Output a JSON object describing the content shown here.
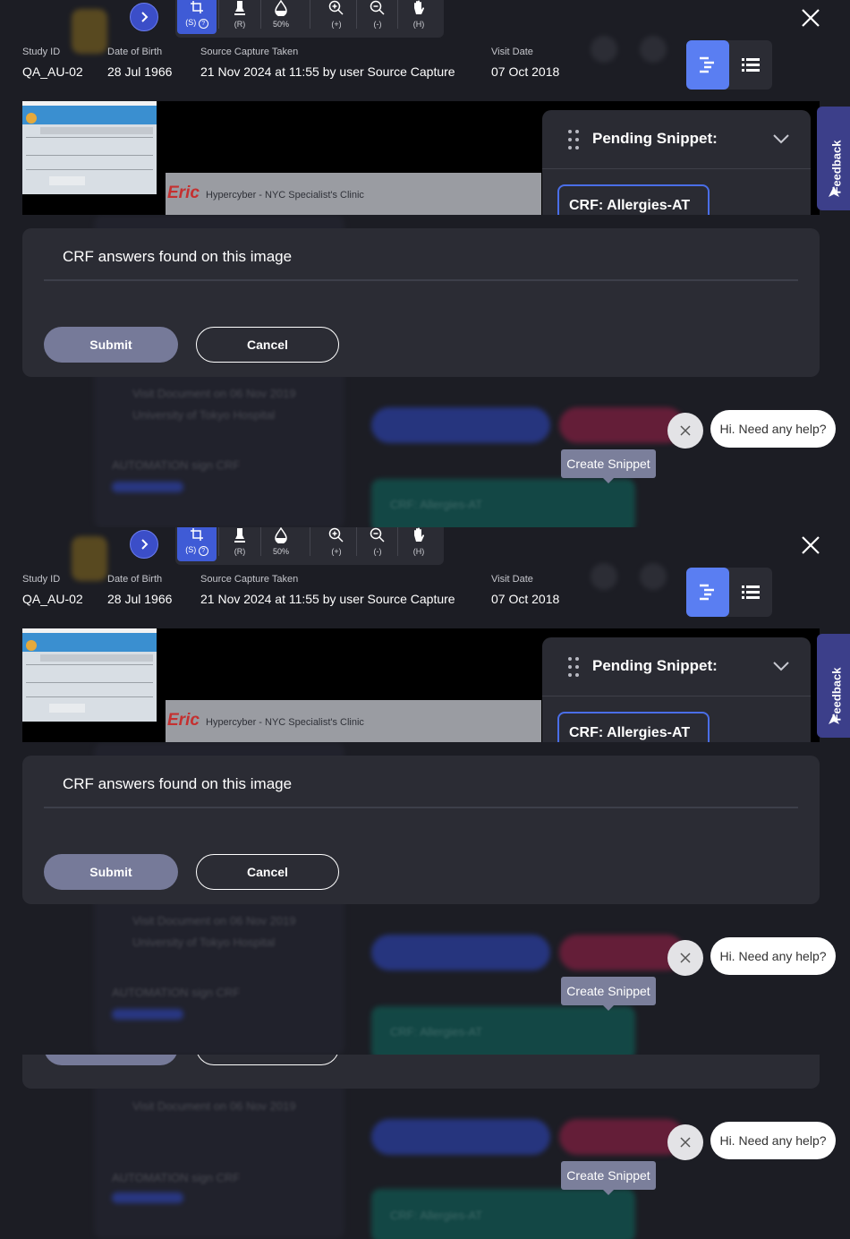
{
  "toolbar": {
    "tools": [
      {
        "key": "(S)",
        "label": "(S)"
      },
      {
        "key": "(R)",
        "label": "(R)"
      },
      {
        "key": "50%",
        "label": "50%"
      },
      {
        "key": "(+)",
        "label": "(+)"
      },
      {
        "key": "(-)",
        "label": "(-)"
      },
      {
        "key": "(H)",
        "label": "(H)"
      }
    ],
    "help_glyph": "?"
  },
  "meta": {
    "study_id_label": "Study ID",
    "study_id": "QA_AU-02",
    "dob_label": "Date of Birth",
    "dob": "28 Jul 1966",
    "capture_label": "Source Capture Taken",
    "capture": "21 Nov 2024 at 11:55 by user Source Capture",
    "visit_label": "Visit Date",
    "visit": "07 Oct 2018"
  },
  "image": {
    "brand": "Eric",
    "clinic": "Hypercyber - NYC Specialist's Clinic"
  },
  "pending": {
    "title": "Pending Snippet:",
    "tag": "CRF: Allergies-AT"
  },
  "feedback": {
    "label": "Feedback"
  },
  "answers": {
    "title": "CRF answers found on this image",
    "submit": "Submit",
    "cancel": "Cancel"
  },
  "help": {
    "text": "Hi. Need any help?"
  },
  "tooltip": {
    "text": "Create Snippet"
  },
  "icons": [
    "chevron-right-icon",
    "crop-icon",
    "help-circle-icon",
    "highlighter-icon",
    "droplet-icon",
    "zoom-in-icon",
    "zoom-out-icon",
    "hand-icon",
    "close-icon",
    "outline-view-icon",
    "list-view-icon",
    "drag-grip-icon",
    "chevron-down-icon",
    "send-icon"
  ],
  "colors": {
    "accent": "#5a7ef2",
    "tool_active": "#3f5bd6",
    "submit": "#767a99",
    "panel": "#2b2c34"
  }
}
